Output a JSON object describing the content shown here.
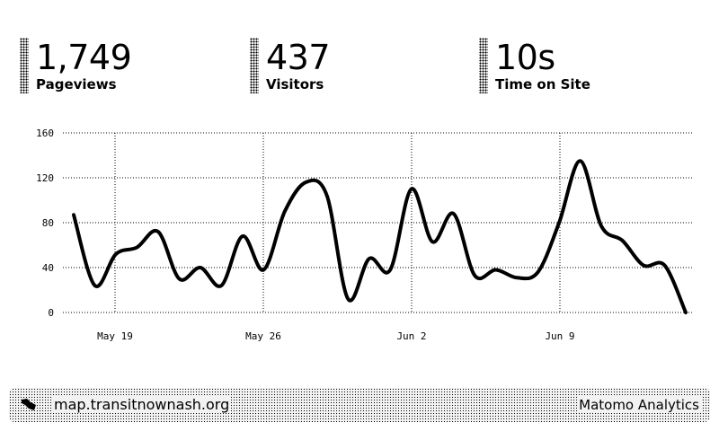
{
  "stats": [
    {
      "value": "1,749",
      "label": "Pageviews"
    },
    {
      "value": "437",
      "label": "Visitors"
    },
    {
      "value": "10s",
      "label": "Time on Site"
    }
  ],
  "chart_data": {
    "type": "line",
    "title": "",
    "xlabel": "",
    "ylabel": "",
    "ylim": [
      0,
      160
    ],
    "y_ticks": [
      "160",
      "120",
      "80",
      "40",
      "0"
    ],
    "x_ticks": [
      "May 19",
      "May 26",
      "Jun 2",
      "Jun 9"
    ],
    "grid": true,
    "line_color": "#000000",
    "series": [
      {
        "values": [
          87,
          24,
          52,
          58,
          72,
          30,
          40,
          24,
          68,
          38,
          90,
          116,
          104,
          12,
          48,
          38,
          110,
          63,
          88,
          33,
          38,
          31,
          36,
          80,
          135,
          77,
          64,
          42,
          42,
          0
        ]
      }
    ]
  },
  "footer": {
    "site": "map.transitnownash.org",
    "brand": "Matomo Analytics"
  }
}
